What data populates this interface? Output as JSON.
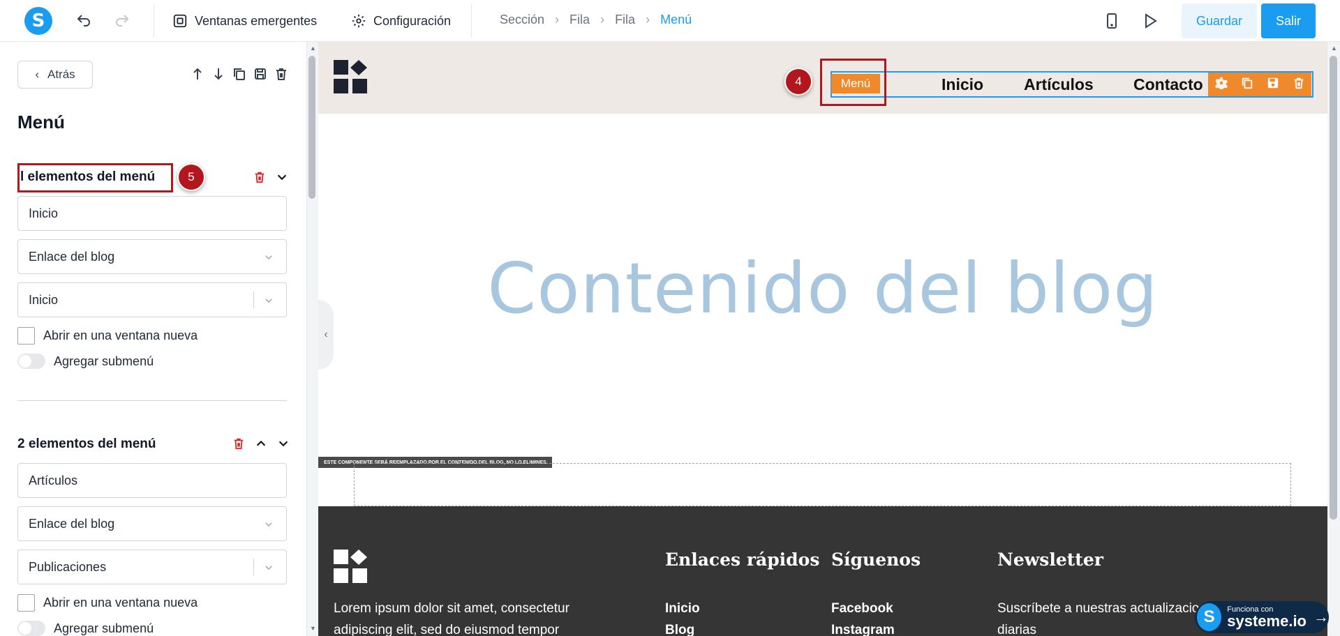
{
  "topbar": {
    "popups_label": "Ventanas emergentes",
    "settings_label": "Configuración",
    "breadcrumbs": [
      "Sección",
      "Fila",
      "Fila",
      "Menú"
    ],
    "save_label": "Guardar",
    "exit_label": "Salir"
  },
  "sidebar": {
    "back_label": "Atrás",
    "title": "Menú",
    "items": [
      {
        "heading": "l elementos del menú",
        "label_value": "Inicio",
        "link_type": "Enlace del blog",
        "target": "Inicio",
        "new_window_label": "Abrir en una ventana nueva",
        "submenu_label": "Agregar submenú"
      },
      {
        "heading": "2 elementos del menú",
        "label_value": "Artículos",
        "link_type": "Enlace del blog",
        "target": "Publicaciones",
        "new_window_label": "Abrir en una ventana nueva",
        "submenu_label": "Agregar submenú"
      }
    ]
  },
  "callouts": {
    "four": "4",
    "five": "5"
  },
  "canvas": {
    "menu_chip": "Menú",
    "nav": [
      "Inicio",
      "Artículos",
      "Contacto"
    ],
    "blog_placeholder": "Contenido del blog",
    "notice": "ESTE COMPONENTE SERÁ REEMPLAZADO POR EL CONTENIDO DEL BLOG, NO LO ELIMINES",
    "footer": {
      "about": "Lorem ipsum dolor sit amet, consectetur",
      "about_2": "adipiscing elit, sed do eiusmod tempor",
      "quick_links_title": "Enlaces rápidos",
      "quick_links": [
        "Inicio",
        "Blog"
      ],
      "follow_title": "Síguenos",
      "follow": [
        "Facebook",
        "Instagram"
      ],
      "newsletter_title": "Newsletter",
      "newsletter_text": "Suscríbete a nuestras actualizaciones",
      "newsletter_text_2": "diarias"
    }
  },
  "powered": {
    "small": "Funciona con",
    "brand": "systeme.io"
  },
  "colors": {
    "accent": "#1a9cf0",
    "orange": "#f0892b",
    "callout": "#b3171e"
  }
}
